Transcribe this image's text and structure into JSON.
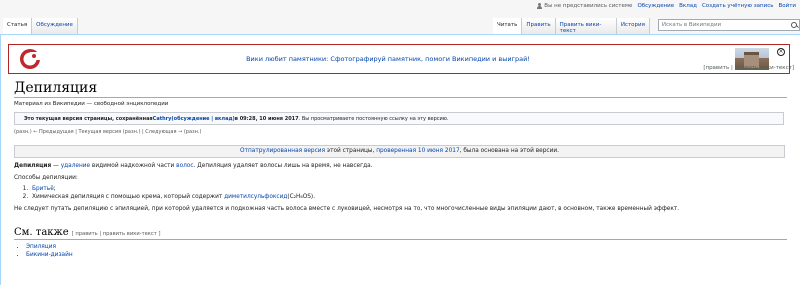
{
  "personal": {
    "anon_text": "Вы не представились системе",
    "links": [
      "Обсуждение",
      "Вклад",
      "Создать учётную запись",
      "Войти"
    ]
  },
  "tabs_left": [
    "Статья",
    "Обсуждение"
  ],
  "tabs_right": [
    "Читать",
    "Править",
    "Править вики-текст",
    "История"
  ],
  "search": {
    "placeholder": "Искать в Википедии"
  },
  "banner": {
    "text": "Вики любит памятники: Сфотографируй памятник, помоги Википедии и выиграй!"
  },
  "article": {
    "title": "Депиляция",
    "tagline": "Материал из Википедии — свободной энциклопедии",
    "edit_links": "[править | править вики-текст]"
  },
  "revision": {
    "part1": "Это текущая версия страницы, сохранённая ",
    "user": "Cathry",
    "part2": " (обсуждение | вклад)",
    "part3": " в 09:28, 10 июня 2017",
    "part4": ". Вы просматриваете постоянную ссылку на эту версию.",
    "nav": "(разн.) ← Предыдущая | Текущая версия (разн.) | Следующая → (разн.)"
  },
  "flagged": {
    "link1": "Отпатрулированная версия",
    "mid": " этой страницы, ",
    "link2": "проверенная",
    "date": " 10 июня 2017",
    "tail": ", была основана на этой версии."
  },
  "body": {
    "intro_bold": "Депиляция",
    "intro_dash": " — ",
    "intro_link1": "удаление",
    "intro_mid": " видимой надкожной части ",
    "intro_link2": "волос",
    "intro_tail": ". Депиляция удаляет волосы лишь на время, не навсегда.",
    "methods_label": "Способы депиляции:",
    "method1_link": "Бритьё",
    "method1_tail": ";",
    "method2_text": "Химическая депиляция с помощью крема, который содержит ",
    "method2_link": "диметилсульфоксид",
    "method2_formula": "(C₂H₆OS).",
    "note": "Не следует путать депиляцию с эпиляцией, при которой удаляется и подкожная часть волоса вместе с луковицей, несмотря на то, что многочисленные виды эпиляции дают, в основном, также временный эффект."
  },
  "see_also": {
    "heading": "См. также",
    "edit": "[ править | править вики-текст ]",
    "items": [
      "Эпиляция",
      "Бикини-дизайн"
    ]
  },
  "colors": {
    "link": "#0645ad",
    "banner_border": "#b32424",
    "banner_logo": "#c1272d"
  }
}
